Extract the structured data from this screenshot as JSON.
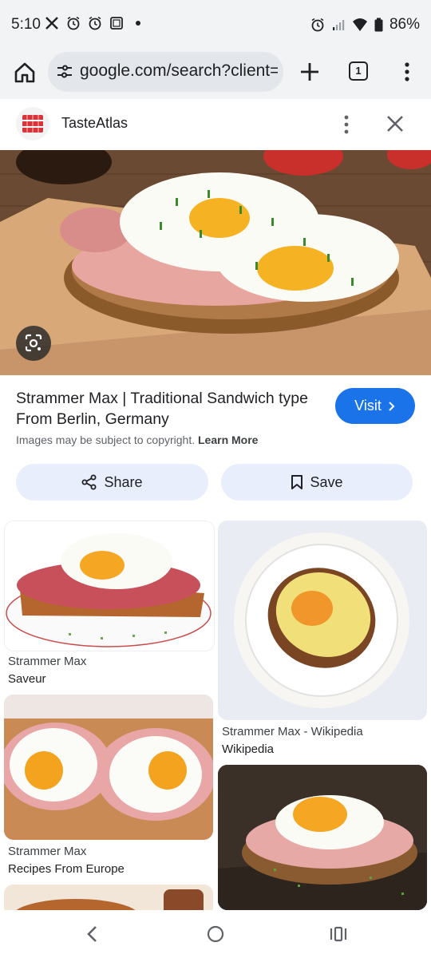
{
  "status": {
    "time": "5:10",
    "left_icons": [
      "x-icon",
      "alarm-icon",
      "alarm-icon",
      "screenshot-icon",
      "dot-icon"
    ],
    "right_icons": [
      "alarm-icon",
      "signal-icon",
      "wifi-icon",
      "battery-icon"
    ],
    "battery": "86%"
  },
  "browser": {
    "url": "google.com/search?client=",
    "tab_count": "1"
  },
  "site": {
    "name": "TasteAtlas"
  },
  "result": {
    "title": "Strammer Max | Traditional Sandwich type From Berlin, Germany",
    "visit_label": "Visit",
    "copyright_text": "Images may be subject to copyright.",
    "learn_more": "Learn More",
    "share_label": "Share",
    "save_label": "Save"
  },
  "related": [
    {
      "title": "Strammer Max",
      "source": "Saveur"
    },
    {
      "title": "Strammer Max - Wikipedia",
      "source": "Wikipedia"
    },
    {
      "title": "Strammer Max",
      "source": "Recipes From Europe"
    },
    {
      "title": "",
      "source": ""
    }
  ],
  "colors": {
    "accent": "#1a73e8",
    "pill_bg": "#e8eefb",
    "chrome_bg": "#f1f3f4"
  }
}
